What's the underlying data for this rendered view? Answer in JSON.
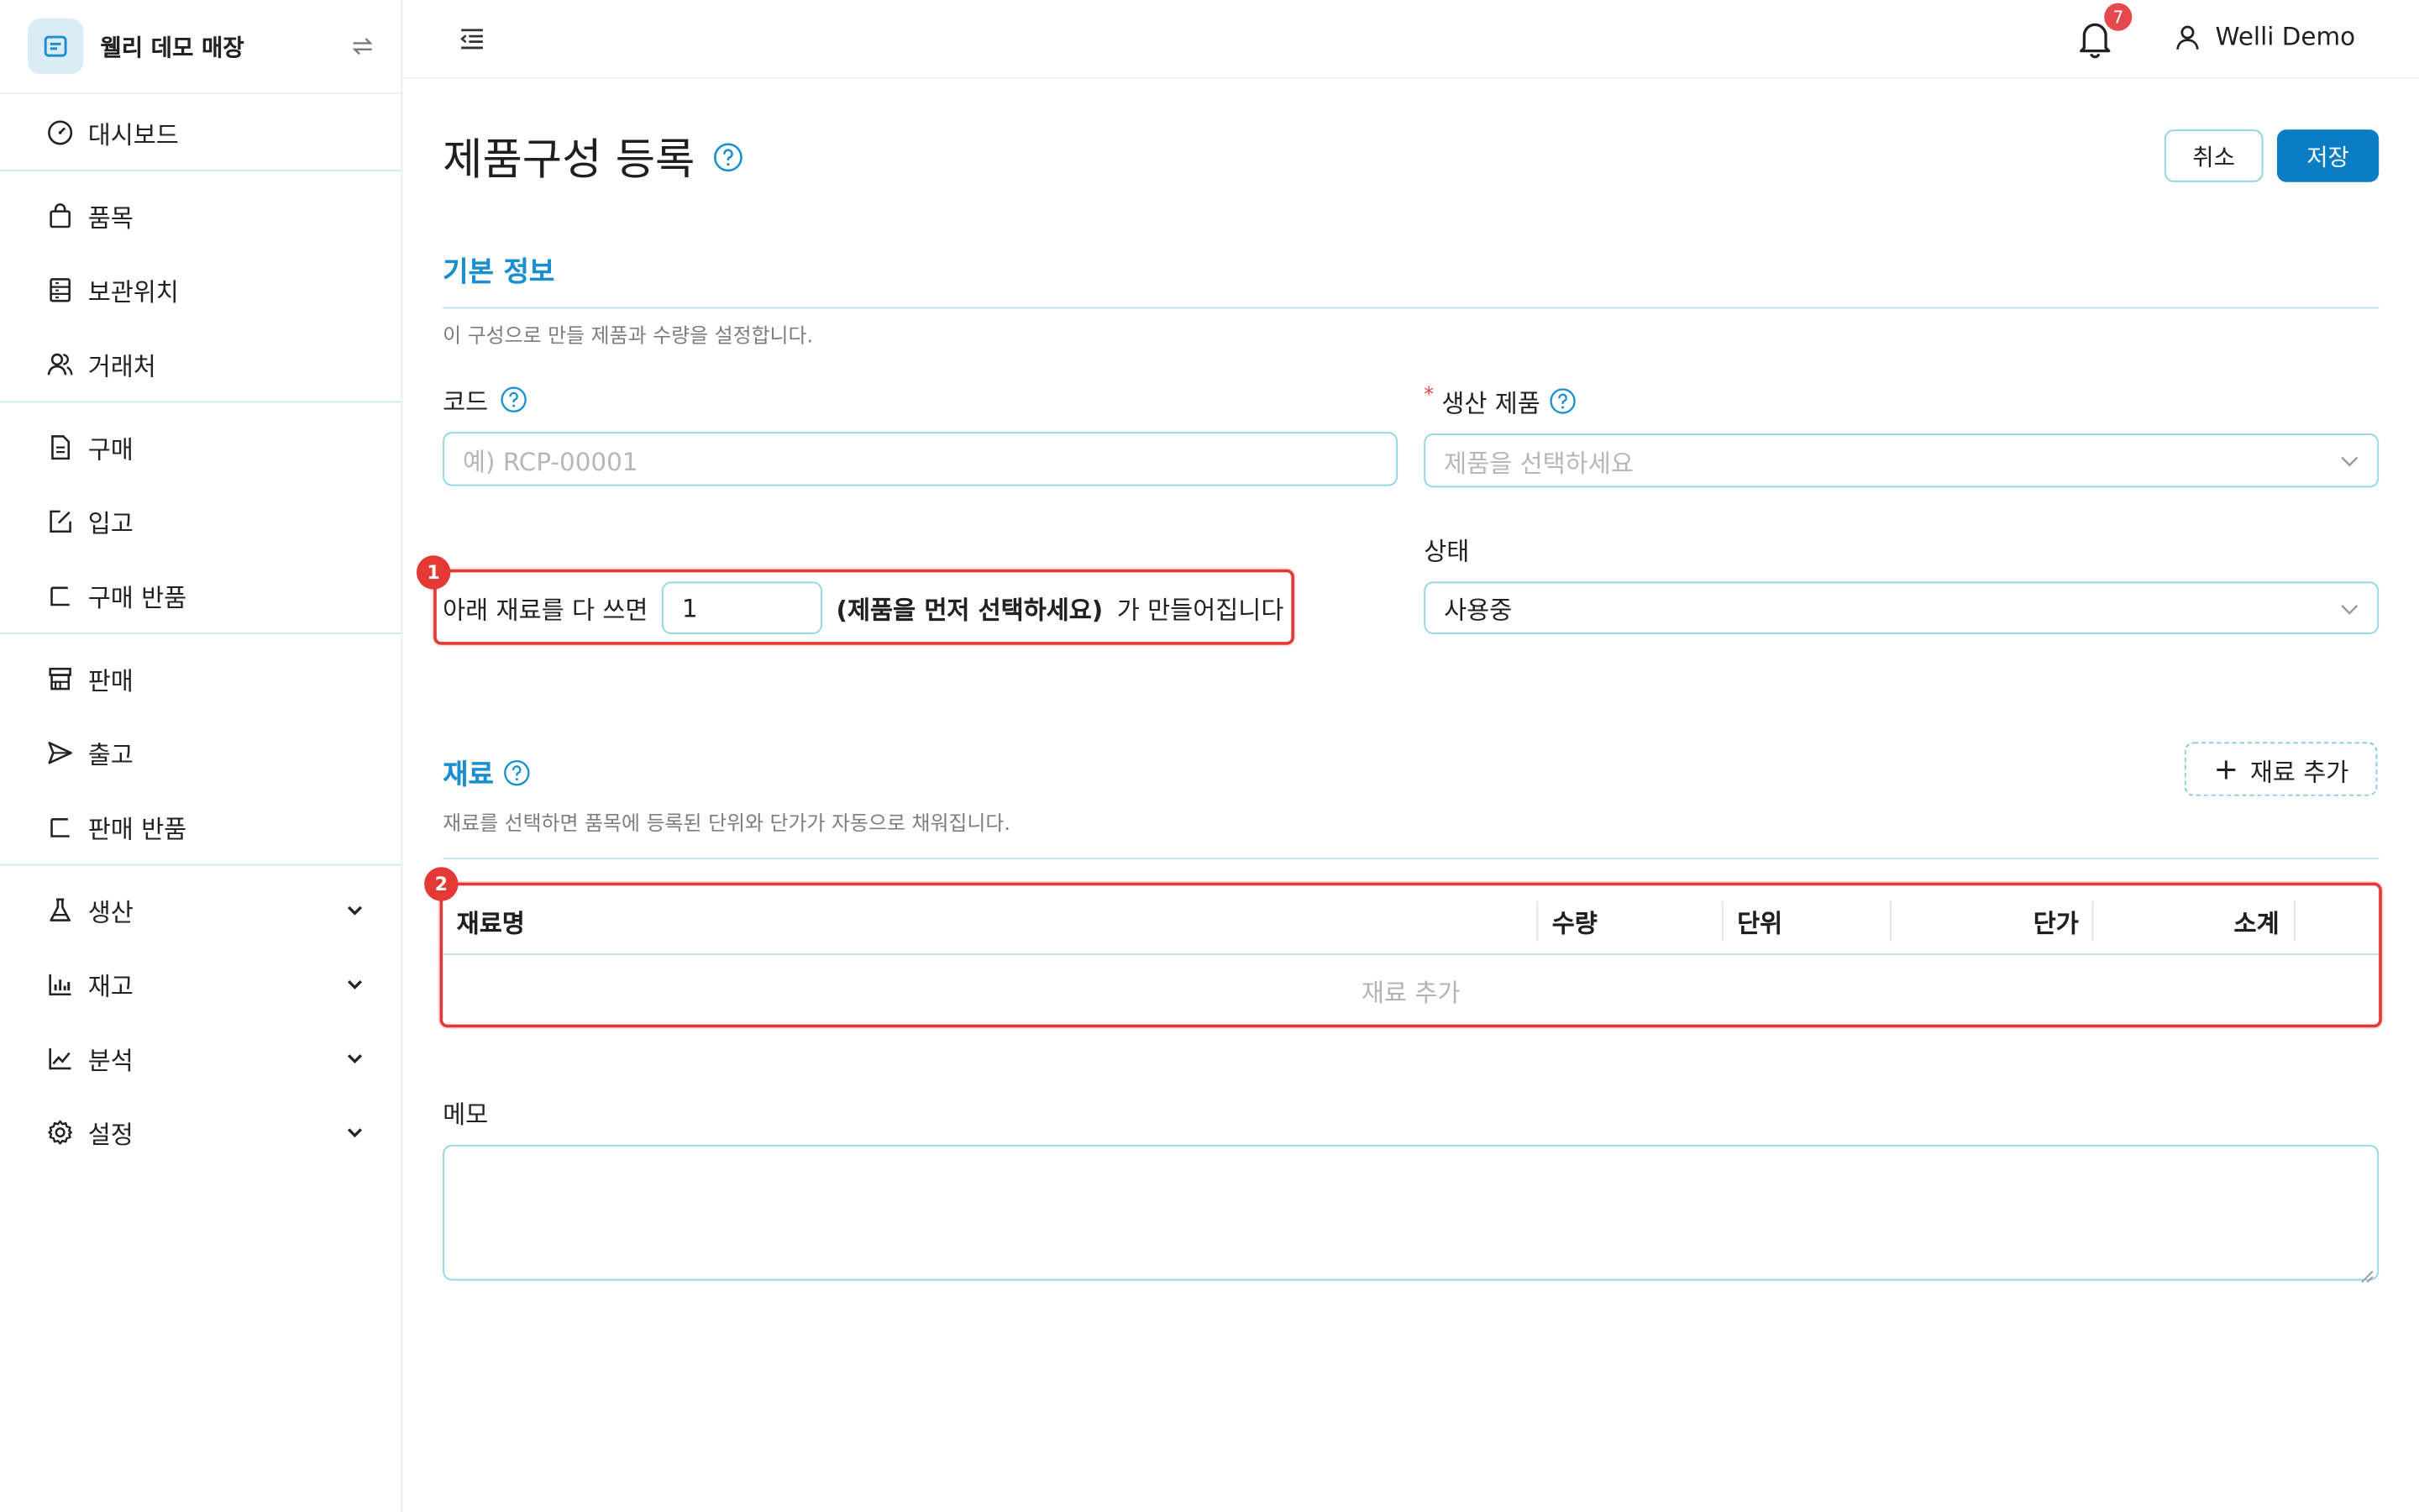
{
  "brand": {
    "name": "웰리 데모 매장",
    "logo_icon": "receipt-icon",
    "swap_icon": "swap-icon"
  },
  "sidebar": {
    "items": [
      {
        "label": "대시보드",
        "icon": "dashboard-gauge-icon"
      },
      {
        "label": "품목",
        "icon": "shopping-bag-icon"
      },
      {
        "label": "보관위치",
        "icon": "shelf-icon"
      },
      {
        "label": "거래처",
        "icon": "users-icon"
      },
      {
        "label": "구매",
        "icon": "document-icon"
      },
      {
        "label": "입고",
        "icon": "edit-box-icon"
      },
      {
        "label": "구매 반품",
        "icon": "return-icon"
      },
      {
        "label": "판매",
        "icon": "store-icon"
      },
      {
        "label": "출고",
        "icon": "send-icon"
      },
      {
        "label": "판매 반품",
        "icon": "return-icon"
      },
      {
        "label": "생산",
        "icon": "flask-icon"
      },
      {
        "label": "재고",
        "icon": "bar-chart-icon"
      },
      {
        "label": "분석",
        "icon": "line-chart-icon"
      },
      {
        "label": "설정",
        "icon": "gear-icon"
      }
    ]
  },
  "header": {
    "notification_count": "7",
    "user_name": "Welli Demo"
  },
  "page": {
    "title": "제품구성 등록",
    "cancel_label": "취소",
    "save_label": "저장"
  },
  "basic": {
    "title": "기본 정보",
    "desc": "이 구성으로 만들 제품과 수량을 설정합니다.",
    "code_label": "코드",
    "code_placeholder": "예) RCP-00001",
    "product_required": "*",
    "product_label": "생산 제품",
    "product_placeholder": "제품을 선택하세요",
    "status_label": "상태",
    "status_value": "사용중",
    "yield_prefix": "아래 재료를 다 쓰면",
    "yield_qty": "1",
    "yield_product": "(제품을 먼저 선택하세요)",
    "yield_suffix": "가 만들어집니다"
  },
  "highlights": {
    "one": "1",
    "two": "2"
  },
  "materials": {
    "title": "재료",
    "desc": "재료를 선택하면 품목에 등록된 단위와 단가가 자동으로 채워집니다.",
    "add_label": "재료 추가",
    "columns": [
      "재료명",
      "수량",
      "단위",
      "단가",
      "소계"
    ],
    "empty_text": "재료 추가"
  },
  "memo": {
    "label": "메모",
    "value": ""
  },
  "colors": {
    "accent": "#0a7cc4",
    "section": "#1a8fd0",
    "highlight": "#e53935",
    "badge": "#e5484d"
  }
}
